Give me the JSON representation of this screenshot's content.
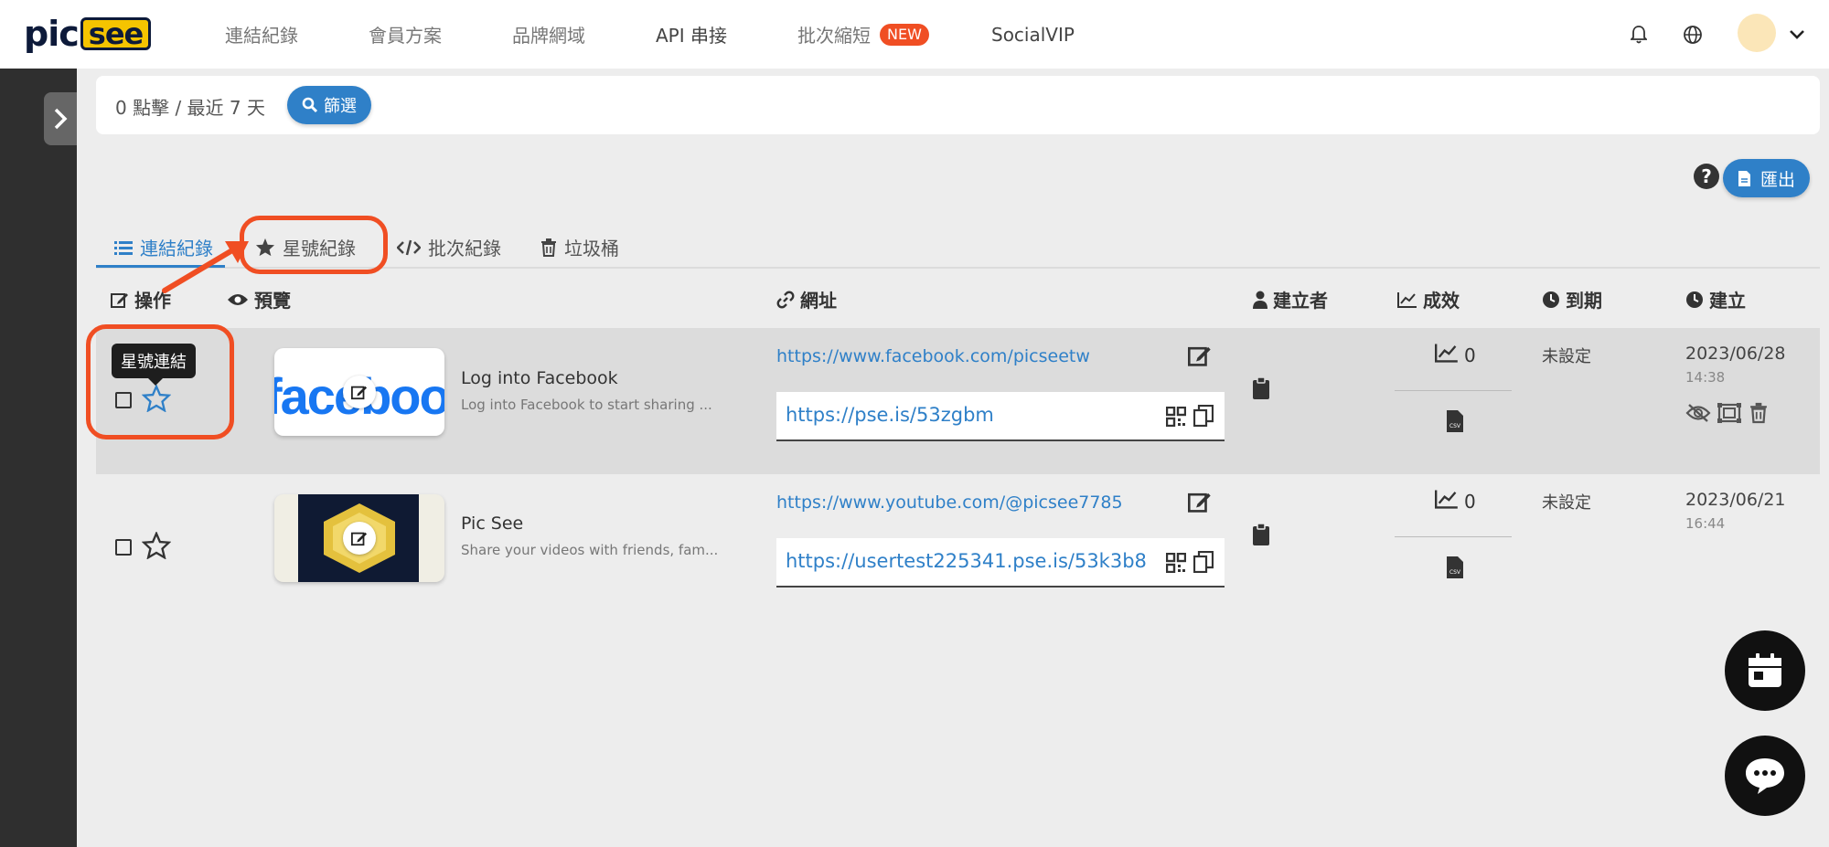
{
  "brand": {
    "logo_left": "pic",
    "logo_right": "see"
  },
  "nav": {
    "items": [
      "連結紀錄",
      "會員方案",
      "品牌網域",
      "API 串接",
      "批次縮短",
      "SocialVIP"
    ],
    "new_badge": "NEW"
  },
  "filter": {
    "summary": "0 點擊 / 最近 7 天",
    "button": "篩選"
  },
  "toolbar": {
    "help": "?",
    "export": "匯出"
  },
  "tabs": [
    "連結紀錄",
    "星號紀錄",
    "批次紀錄",
    "垃圾桶"
  ],
  "columns": {
    "action": "操作",
    "preview": "預覽",
    "url": "網址",
    "creator": "建立者",
    "performance": "成效",
    "expire": "到期",
    "created": "建立"
  },
  "tooltip": "星號連結",
  "rows": [
    {
      "thumb_text": "facebook",
      "title": "Log into Facebook",
      "desc": "Log into Facebook to start sharing ...",
      "original_url": "https://www.facebook.com/picseetw",
      "short_url": "https://pse.is/53zgbm",
      "clicks": "0",
      "expire": "未設定",
      "date": "2023/06/28",
      "time": "14:38"
    },
    {
      "thumb_text": "",
      "title": "Pic See",
      "desc": "Share your videos with friends, fam...",
      "original_url": "https://www.youtube.com/@picsee7785",
      "short_url": "https://usertest225341.pse.is/53k3b8",
      "clicks": "0",
      "expire": "未設定",
      "date": "2023/06/21",
      "time": "16:44"
    }
  ],
  "colors": {
    "accent": "#2f80c8",
    "annotation": "#f04e23",
    "badge": "#f04e23",
    "sidebar": "#2f2f2f"
  }
}
